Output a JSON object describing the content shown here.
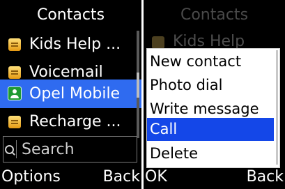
{
  "left_screen": {
    "title": "Contacts",
    "contacts": [
      {
        "name": "Kids Help ...",
        "icon": "contact-card-icon"
      },
      {
        "name": "Voicemail",
        "icon": "contact-card-icon"
      },
      {
        "name": "Opel Mobile",
        "icon": "person-icon",
        "selected": true
      },
      {
        "name": "Recharge ...",
        "icon": "contact-card-icon"
      }
    ],
    "search": {
      "placeholder": "Search",
      "icon": "search-icon"
    },
    "softkeys": {
      "left": "Options",
      "right": "Back"
    }
  },
  "right_screen": {
    "title": "Contacts",
    "background_item": "Kids Help",
    "menu": [
      {
        "label": "New contact"
      },
      {
        "label": "Photo dial"
      },
      {
        "label": "Write message"
      },
      {
        "label": "Call",
        "selected": true
      },
      {
        "label": "Delete"
      }
    ],
    "softkeys": {
      "left": "OK",
      "right": "Back"
    }
  },
  "colors": {
    "screen_background": "#000000",
    "highlight_left": "#2f6bf0",
    "highlight_menu": "#1447e8",
    "menu_background": "#ffffff"
  }
}
